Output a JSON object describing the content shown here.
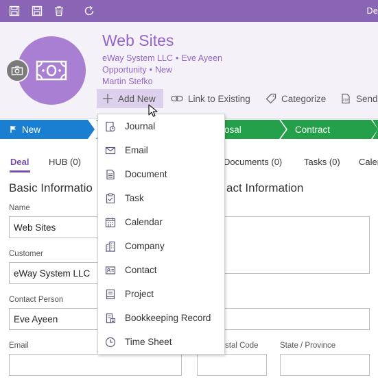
{
  "toolbar": {
    "buttons": [
      "save-close-icon",
      "save-icon",
      "delete-icon",
      "refresh-icon"
    ],
    "user_label": "De",
    "color": "#8a65b5"
  },
  "record": {
    "title": "Web Sites",
    "line1_a": "eWay System LLC",
    "line1_b": "Eve Ayeen",
    "line2_a": "Opportunity",
    "line2_b": "New",
    "line3": "Martin Stefko",
    "accent": "#9366c6"
  },
  "actions": {
    "add_new": "Add New",
    "link_existing": "Link to Existing",
    "categorize": "Categorize",
    "send": "Send"
  },
  "stages": [
    {
      "label": "New",
      "color": "#1a7fd0"
    },
    {
      "label": "osal",
      "color": "#24a04a"
    },
    {
      "label": "Contract",
      "color": "#24a04a"
    }
  ],
  "tabs": {
    "deal": "Deal",
    "hub": "HUB (0)",
    "documents": "Documents (0)",
    "tasks": "Tasks (0)",
    "cal": "Calen"
  },
  "sections": {
    "basic": "Basic Informatio",
    "contact": "act Information"
  },
  "fields": {
    "name_label": "Name",
    "name_value": "Web Sites",
    "customer_label": "Customer",
    "customer_value": "eWay System LLC",
    "contact_person_label": "Contact Person",
    "contact_person_value": "Eve Ayeen",
    "email_label": "Email",
    "postal_label": "stal Code",
    "state_label": "State / Province"
  },
  "dropdown": {
    "items": [
      {
        "label": "Journal",
        "icon": "journal-icon"
      },
      {
        "label": "Email",
        "icon": "email-icon"
      },
      {
        "label": "Document",
        "icon": "document-icon"
      },
      {
        "label": "Task",
        "icon": "task-icon"
      },
      {
        "label": "Calendar",
        "icon": "calendar-icon"
      },
      {
        "label": "Company",
        "icon": "company-icon"
      },
      {
        "label": "Contact",
        "icon": "contact-icon"
      },
      {
        "label": "Project",
        "icon": "project-icon"
      },
      {
        "label": "Bookkeeping Record",
        "icon": "bookkeeping-icon"
      },
      {
        "label": "Time Sheet",
        "icon": "time-sheet-icon"
      }
    ]
  }
}
